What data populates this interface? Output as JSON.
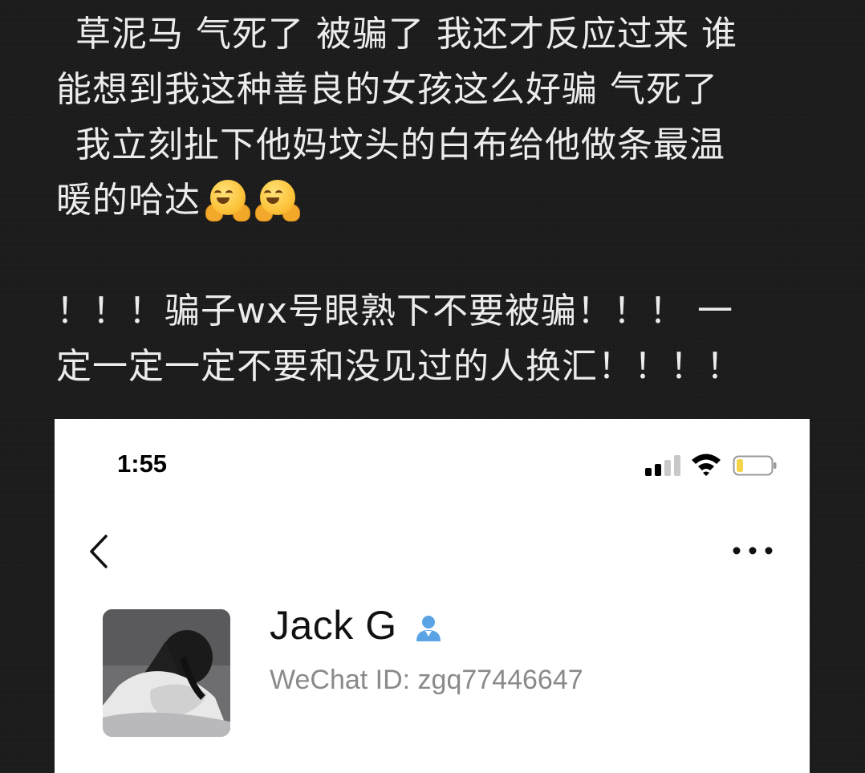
{
  "post": {
    "line1": "草泥马 气死了 被骗了 我还才反应过来 谁",
    "line2": "能想到我这种善良的女孩这么好骗 气死了",
    "line3": "我立刻扯下他妈坟头的白布给他做条最温",
    "line4": "暖的哈达",
    "line4_emojis": [
      "hugging-face-emoji",
      "hugging-face-emoji"
    ],
    "line5": "！！！骗子wx号眼熟下不要被骗！！！ 一",
    "line6": "定一定一定不要和没见过的人换汇！！！！"
  },
  "screenshot": {
    "status_bar": {
      "time": "1:55",
      "icons": [
        "signal-icon",
        "wifi-icon",
        "battery-icon"
      ],
      "battery_color": "#f5d44b"
    },
    "nav": {
      "back_icon": "chevron-left-icon",
      "more_icon": "more-dots-icon"
    },
    "profile": {
      "name": "Jack G",
      "gender_icon": "male-gender-icon",
      "gender_color": "#5aa4e6",
      "wechat_id": "WeChat ID: zgq77446647"
    }
  }
}
